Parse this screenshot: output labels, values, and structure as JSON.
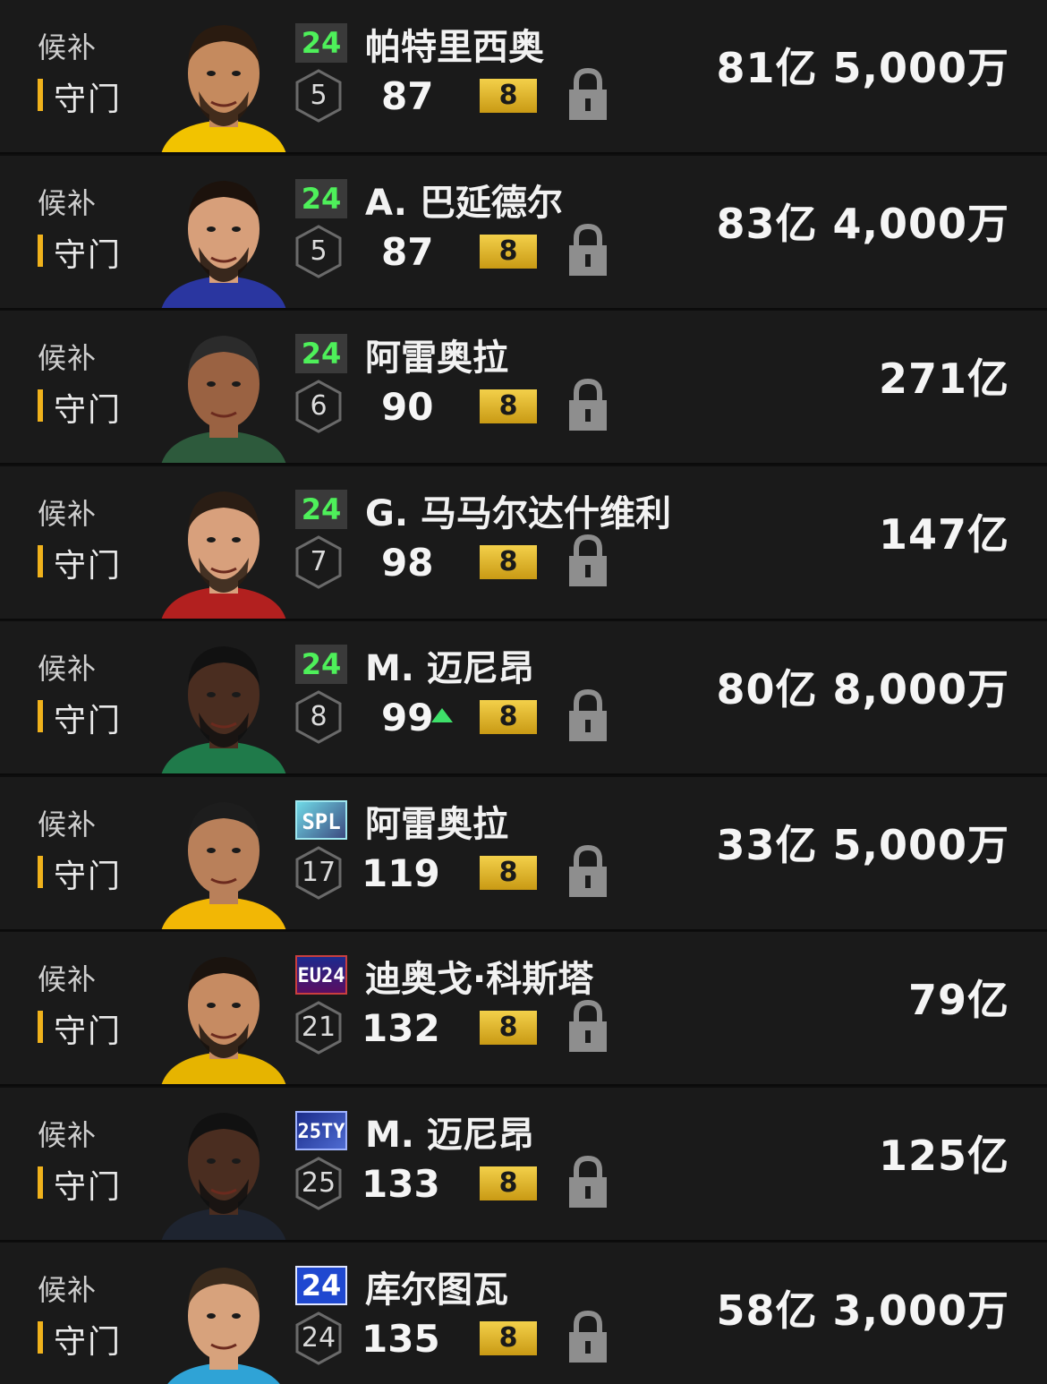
{
  "rows": [
    {
      "status": "候补",
      "position": "守门",
      "season": "24",
      "season_style": "green",
      "name": "帕特里西奥",
      "level": "5",
      "ovr": "87",
      "ovr_up": false,
      "grade": "8",
      "price": "81亿 5,000万",
      "jersey": "#f2c300",
      "skin": "#c58a5e",
      "hair": "#2a1b10",
      "beard": true
    },
    {
      "status": "候补",
      "position": "守门",
      "season": "24",
      "season_style": "green",
      "name": "A. 巴延德尔",
      "level": "5",
      "ovr": "87",
      "ovr_up": false,
      "grade": "8",
      "price": "83亿 4,000万",
      "jersey": "#2a36a0",
      "skin": "#d79f7a",
      "hair": "#1c120c",
      "beard": true
    },
    {
      "status": "候补",
      "position": "守门",
      "season": "24",
      "season_style": "green",
      "name": "阿雷奥拉",
      "level": "6",
      "ovr": "90",
      "ovr_up": false,
      "grade": "8",
      "price": "271亿",
      "jersey": "#2d5a3c",
      "skin": "#9a6242",
      "hair": "#2b2b2b",
      "beard": false
    },
    {
      "status": "候补",
      "position": "守门",
      "season": "24",
      "season_style": "green",
      "name": "G. 马马尔达什维利",
      "level": "7",
      "ovr": "98",
      "ovr_up": false,
      "grade": "8",
      "price": "147亿",
      "jersey": "#b2201f",
      "skin": "#d8a07c",
      "hair": "#2a1d14",
      "beard": true
    },
    {
      "status": "候补",
      "position": "守门",
      "season": "24",
      "season_style": "green",
      "name": "M. 迈尼昂",
      "level": "8",
      "ovr": "99",
      "ovr_up": true,
      "grade": "8",
      "price": "80亿 8,000万",
      "jersey": "#1f7a4a",
      "skin": "#4a2d20",
      "hair": "#111111",
      "beard": true
    },
    {
      "status": "候补",
      "position": "守门",
      "season": "SPL",
      "season_style": "spl",
      "name": "阿雷奥拉",
      "level": "17",
      "ovr": "119",
      "ovr_up": false,
      "grade": "8",
      "price": "33亿 5,000万",
      "jersey": "#f2b705",
      "skin": "#b9805a",
      "hair": "#1d1d1d",
      "beard": false
    },
    {
      "status": "候补",
      "position": "守门",
      "season": "EU24",
      "season_style": "eu",
      "name": "迪奥戈·科斯塔",
      "level": "21",
      "ovr": "132",
      "ovr_up": false,
      "grade": "8",
      "price": "79亿",
      "jersey": "#e6b400",
      "skin": "#c68b62",
      "hair": "#1a130e",
      "beard": true
    },
    {
      "status": "候补",
      "position": "守门",
      "season": "25TY",
      "season_style": "ty",
      "name": "M. 迈尼昂",
      "level": "25",
      "ovr": "133",
      "ovr_up": false,
      "grade": "8",
      "price": "125亿",
      "jersey": "#1e2430",
      "skin": "#4a2d20",
      "hair": "#111111",
      "beard": true
    },
    {
      "status": "候补",
      "position": "守门",
      "season": "24",
      "season_style": "blue",
      "name": "库尔图瓦",
      "level": "24",
      "ovr": "135",
      "ovr_up": false,
      "grade": "8",
      "price": "58亿 3,000万",
      "jersey": "#2fa3d6",
      "skin": "#d7a27c",
      "hair": "#3a2a1c",
      "beard": false
    }
  ]
}
